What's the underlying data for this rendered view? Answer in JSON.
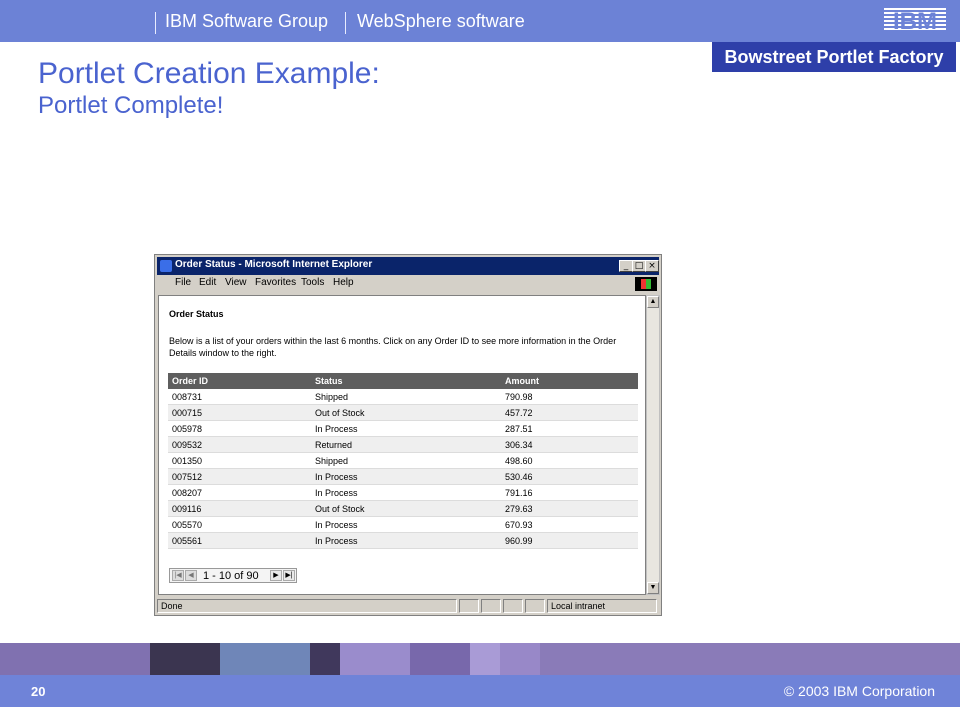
{
  "header": {
    "group_text": "IBM Software Group",
    "product_text": "WebSphere software",
    "subtitle_box": "Bowstreet Portlet Factory",
    "logo_text": "IBM",
    "title_line1": "Portlet Creation Example:",
    "title_line2": "Portlet Complete!"
  },
  "browser": {
    "window_title": "Order Status - Microsoft Internet Explorer",
    "menu": [
      "File",
      "Edit",
      "View",
      "Favorites",
      "Tools",
      "Help"
    ],
    "status_text": "Done",
    "zone_text": "Local intranet"
  },
  "page": {
    "heading": "Order Status",
    "description": "Below is a list of your orders within the last 6 months. Click on any Order ID to see more information in the Order Details window to the right.",
    "columns": [
      "Order ID",
      "Status",
      "Amount"
    ],
    "rows": [
      {
        "id": "008731",
        "status": "Shipped",
        "amount": "790.98"
      },
      {
        "id": "000715",
        "status": "Out of Stock",
        "amount": "457.72"
      },
      {
        "id": "005978",
        "status": "In Process",
        "amount": "287.51"
      },
      {
        "id": "009532",
        "status": "Returned",
        "amount": "306.34"
      },
      {
        "id": "001350",
        "status": "Shipped",
        "amount": "498.60"
      },
      {
        "id": "007512",
        "status": "In Process",
        "amount": "530.46"
      },
      {
        "id": "008207",
        "status": "In Process",
        "amount": "791.16"
      },
      {
        "id": "009116",
        "status": "Out of Stock",
        "amount": "279.63"
      },
      {
        "id": "005570",
        "status": "In Process",
        "amount": "670.93"
      },
      {
        "id": "005561",
        "status": "In Process",
        "amount": "960.99"
      }
    ],
    "pager_text": "1 - 10 of 90"
  },
  "footer": {
    "page_number": "20",
    "copyright": "© 2003 IBM Corporation"
  },
  "colors": {
    "header_bar": "#6c82d6",
    "subtitle_box": "#2e3fa9",
    "title_text": "#4a63cf",
    "table_header": "#5e5e5e",
    "footer_bar": "#6f83d8"
  }
}
